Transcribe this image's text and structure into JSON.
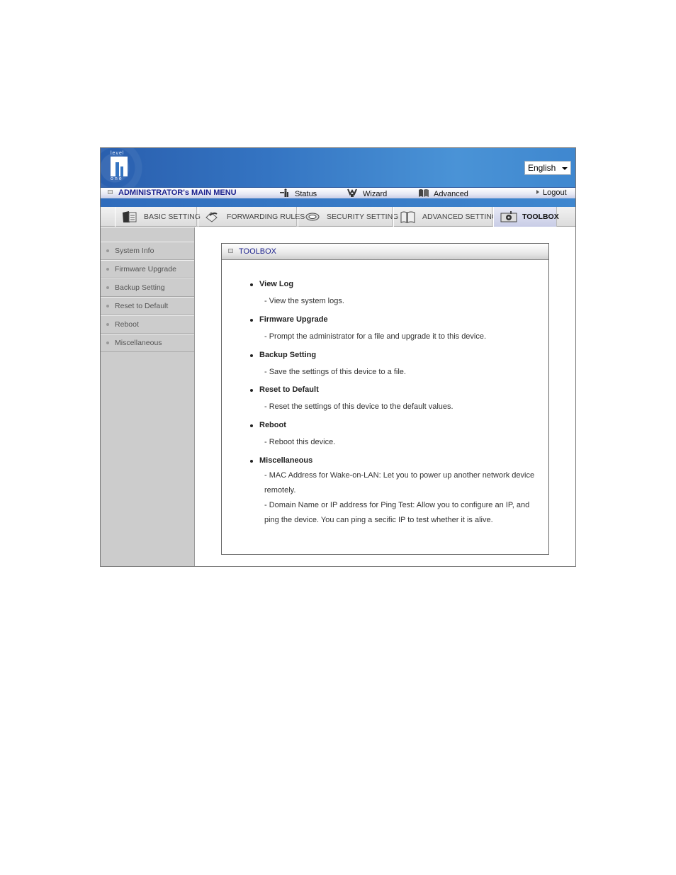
{
  "header": {
    "logo": {
      "top": "level",
      "bottom": "one"
    },
    "language": {
      "selected": "English"
    }
  },
  "menubar": {
    "title": "ADMINISTRATOR's MAIN MENU",
    "items": [
      {
        "label": "Status",
        "icon": "status-icon"
      },
      {
        "label": "Wizard",
        "icon": "wizard-icon"
      },
      {
        "label": "Advanced",
        "icon": "advanced-icon"
      }
    ],
    "logout": "Logout"
  },
  "tabs": [
    {
      "label": "BASIC SETTING",
      "icon": "folder-icon",
      "active": false
    },
    {
      "label": "FORWARDING RULES",
      "icon": "forwarding-icon",
      "active": false
    },
    {
      "label": "SECURITY SETTING",
      "icon": "security-icon",
      "active": false
    },
    {
      "label": "ADVANCED SETTING",
      "icon": "advanced-setting-icon",
      "active": false
    },
    {
      "label": "TOOLBOX",
      "icon": "toolbox-icon",
      "active": true
    }
  ],
  "sidebar": {
    "items": [
      {
        "label": "System Info"
      },
      {
        "label": "Firmware Upgrade"
      },
      {
        "label": "Backup Setting"
      },
      {
        "label": "Reset to Default"
      },
      {
        "label": "Reboot"
      },
      {
        "label": "Miscellaneous"
      }
    ]
  },
  "panel": {
    "title": "TOOLBOX",
    "entries": [
      {
        "name": "View Log",
        "desc": [
          "- View the system logs."
        ]
      },
      {
        "name": "Firmware Upgrade",
        "desc": [
          "- Prompt the administrator for a file and upgrade it to this device."
        ]
      },
      {
        "name": "Backup Setting",
        "desc": [
          "- Save the settings of this device to a file."
        ]
      },
      {
        "name": "Reset to Default",
        "desc": [
          "- Reset the settings of this device to the default values."
        ]
      },
      {
        "name": "Reboot",
        "desc": [
          "- Reboot this device."
        ]
      },
      {
        "name": "Miscellaneous",
        "desc": [
          "- MAC Address for Wake-on-LAN: Let you to power up another network device remotely.",
          "- Domain Name or IP address for Ping Test: Allow you to configure an IP, and ping the device. You can ping a secific IP to test whether it is alive."
        ]
      }
    ]
  }
}
